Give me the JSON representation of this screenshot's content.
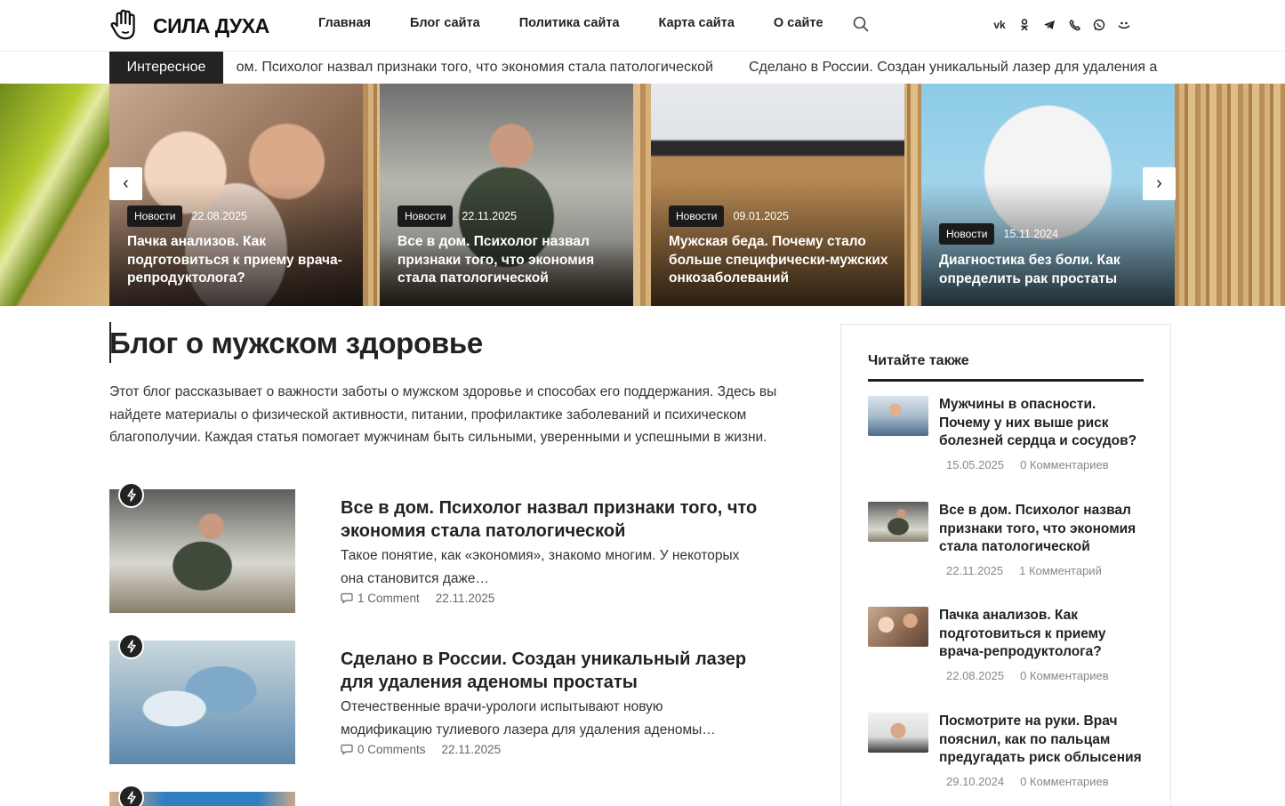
{
  "brand": {
    "name": "СИЛА ДУХА"
  },
  "nav": [
    "Главная",
    "Блог сайта",
    "Политика сайта",
    "Карта сайта",
    "О сайте"
  ],
  "socials": [
    "vk",
    "ok",
    "telegram",
    "viber",
    "whatsapp",
    "rutube"
  ],
  "ticker": {
    "label": "Интересное",
    "items": [
      "е в дом. Психолог назвал признаки того, что экономия стала патологической",
      "Сделано в России. Создан уникальный лазер для удаления а"
    ]
  },
  "slider": {
    "prev": "‹",
    "next": "›",
    "slides": [
      {
        "category": "Новости",
        "date": "22.08.2025",
        "title": "Пачка анализов. Как подготовиться к приему врача-репродуктолога?"
      },
      {
        "category": "Новости",
        "date": "22.11.2025",
        "title": "Все в дом. Психолог назвал признаки того, что экономия стала патологической"
      },
      {
        "category": "Новости",
        "date": "09.01.2025",
        "title": "Мужская беда. Почему стало больше специфически-мужских онкозаболеваний"
      },
      {
        "category": "Новости",
        "date": "15.11.2024",
        "title": "Диагностика без боли. Как определить рак простаты"
      }
    ]
  },
  "main": {
    "title": "Блог о мужском здоровье",
    "intro": "Этот блог рассказывает о важности заботы о мужском здоровье и способах его поддержания. Здесь вы найдете материалы о физической активности, питании, профилактике заболеваний и психическом благополучии. Каждая статья помогает мужчинам быть сильными, уверенными и успешными в жизни.",
    "posts": [
      {
        "title": "Все в дом. Психолог назвал признаки того, что экономия стала патологической",
        "excerpt": "Такое понятие, как «экономия», знакомо многим. У некоторых она становится даже…",
        "comments": "1 Comment",
        "date": "22.11.2025"
      },
      {
        "title": "Сделано в России. Создан уникальный лазер для удаления аденомы простаты",
        "excerpt": "Отечественные врачи-урологи испытывают новую модификацию тулиевого лазера для удаления аденомы…",
        "comments": "0 Comments",
        "date": "22.11.2025"
      }
    ]
  },
  "sidebar": {
    "title": "Читайте также",
    "items": [
      {
        "title": "Мужчины в опасности. Почему у них выше риск болезней сердца и сосудов?",
        "date": "15.05.2025",
        "comments": "0 Комментариев"
      },
      {
        "title": "Все в дом. Психолог назвал признаки того, что экономия стала патологической",
        "date": "22.11.2025",
        "comments": "1 Комментарий"
      },
      {
        "title": "Пачка анализов. Как подготовиться к приему врача-репродуктолога?",
        "date": "22.08.2025",
        "comments": "0 Комментариев"
      },
      {
        "title": "Посмотрите на руки. Врач пояснил, как по пальцам предугадать риск облысения",
        "date": "29.10.2024",
        "comments": "0 Комментариев"
      }
    ]
  }
}
